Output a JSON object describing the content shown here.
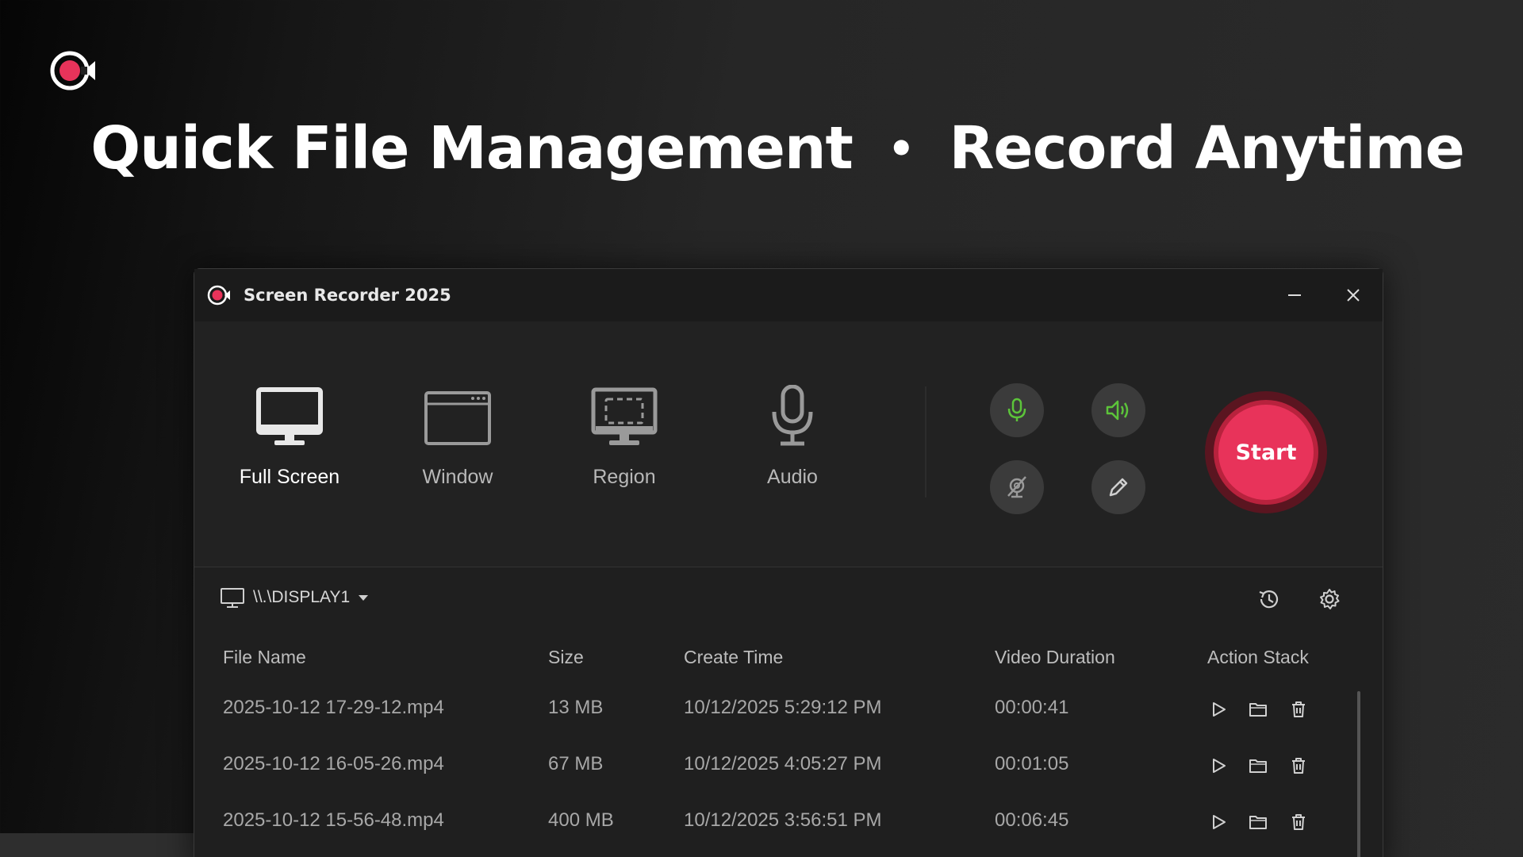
{
  "headline": {
    "left": "Quick File Management",
    "separator": "•",
    "right": "Record Anytime"
  },
  "app": {
    "title": "Screen Recorder 2025",
    "brand_color": "#e8335a",
    "icons": {
      "minimize": "minimize-icon",
      "close": "close-icon",
      "logo": "record-logo-icon"
    }
  },
  "toolbar": {
    "modes": [
      {
        "label": "Full Screen",
        "icon": "monitor-icon",
        "active": true
      },
      {
        "label": "Window",
        "icon": "window-icon",
        "active": false
      },
      {
        "label": "Region",
        "icon": "region-icon",
        "active": false
      },
      {
        "label": "Audio",
        "icon": "microphone-icon",
        "active": false
      }
    ],
    "toggles": [
      {
        "icon": "microphone-icon",
        "color": "#5cc43a"
      },
      {
        "icon": "speaker-icon",
        "color": "#5cc43a"
      },
      {
        "icon": "camera-off-icon",
        "color": "#9a9a9a"
      },
      {
        "icon": "pen-icon",
        "color": "#cfcfcf"
      }
    ],
    "start_label": "Start"
  },
  "files": {
    "display": "\\\\.\\DISPLAY1",
    "columns": [
      "File Name",
      "Size",
      "Create Time",
      "Video Duration",
      "Action Stack"
    ],
    "rows": [
      {
        "name": "2025-10-12 17-29-12.mp4",
        "size": "13 MB",
        "created": "10/12/2025 5:29:12 PM",
        "duration": "00:00:41"
      },
      {
        "name": "2025-10-12 16-05-26.mp4",
        "size": "67 MB",
        "created": "10/12/2025 4:05:27 PM",
        "duration": "00:01:05"
      },
      {
        "name": "2025-10-12 15-56-48.mp4",
        "size": "400 MB",
        "created": "10/12/2025 3:56:51 PM",
        "duration": "00:06:45"
      }
    ],
    "actions": [
      "play-icon",
      "folder-icon",
      "trash-icon"
    ]
  }
}
